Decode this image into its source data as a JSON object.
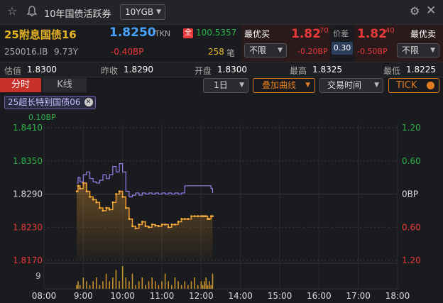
{
  "header": {
    "title": "10年国债活跃券",
    "code_select": "10YGB"
  },
  "quote": {
    "name": "25附息国债16",
    "price": "1.8250",
    "source": "TKN",
    "all_badge": "全",
    "all_value": "100.5357",
    "code": "250016.IB",
    "tenor": "9.73Y",
    "change": "-0.40BP",
    "volume": "258",
    "volume_unit": "笔"
  },
  "bid": {
    "label": "最优买",
    "price_main": "1.82",
    "price_sup": "70",
    "limit": "不限",
    "change": "-0.20BP"
  },
  "spread": {
    "label": "价差",
    "value": "0.30"
  },
  "ask": {
    "label": "最优卖",
    "price_main": "1.82",
    "price_sup": "40",
    "limit": "不限",
    "change": "-0.50BP"
  },
  "stats": [
    {
      "label": "估值",
      "value": "1.8300"
    },
    {
      "label": "昨收",
      "value": "1.8290"
    },
    {
      "label": "开盘",
      "value": "1.8300"
    },
    {
      "label": "最高",
      "value": "1.8325"
    },
    {
      "label": "最低",
      "value": "1.8225"
    }
  ],
  "tabs": [
    {
      "label": "分时",
      "active": true
    },
    {
      "label": "K线",
      "active": false
    }
  ],
  "controls": {
    "period": "1日",
    "overlay": "叠加曲线",
    "session": "交易时间",
    "tick": "TICK"
  },
  "overlay_tag": "25超长特别国债06",
  "colors": {
    "up": "#e8393a",
    "down": "#2db34a",
    "main_line": "#f0a030",
    "overlay_line": "#9b7ff0",
    "accent": "#e07a1f"
  },
  "chart_data": {
    "type": "line",
    "top_label": "0.10BP",
    "y_left_ticks": [
      "1.8410",
      "1.8350",
      "1.8290",
      "1.8230",
      "1.8170"
    ],
    "y_right_ticks": [
      "1.20",
      "0.60",
      "0BP",
      "0.60",
      "1.20"
    ],
    "ylim": [
      1.817,
      1.841
    ],
    "x_ticks": [
      "08:00",
      "9:00",
      "10:00",
      "11:00",
      "12:00",
      "14:00",
      "15:00",
      "16:00",
      "17:00",
      "18:00"
    ],
    "volume_label": "9",
    "series": [
      {
        "name": "25附息国债16",
        "x": [
          "08:50",
          "08:52",
          "08:55",
          "09:00",
          "09:05",
          "09:10",
          "09:15",
          "09:20",
          "09:25",
          "09:30",
          "09:35",
          "09:40",
          "09:45",
          "09:50",
          "09:55",
          "10:00",
          "10:05",
          "10:10",
          "10:15",
          "10:20",
          "10:25",
          "10:30",
          "10:35",
          "10:40",
          "10:45",
          "10:50",
          "10:55",
          "11:00",
          "11:05",
          "11:10",
          "11:15",
          "11:20",
          "11:25",
          "11:30",
          "11:35",
          "11:40",
          "11:45",
          "11:50",
          "11:55",
          "12:00",
          "12:05",
          "12:10",
          "12:15",
          "12:20",
          "12:25",
          "12:30",
          "12:35"
        ],
        "values": [
          1.8295,
          1.8305,
          1.83,
          1.831,
          1.8295,
          1.8285,
          1.828,
          1.8275,
          1.8265,
          1.826,
          1.8265,
          1.8262,
          1.8275,
          1.829,
          1.8295,
          1.8285,
          1.8265,
          1.8245,
          1.8232,
          1.8228,
          1.8235,
          1.824,
          1.8232,
          1.823,
          1.8235,
          1.8233,
          1.8232,
          1.8235,
          1.8235,
          1.823,
          1.8235,
          1.8235,
          1.824,
          1.8245,
          1.8245,
          1.8245,
          1.825,
          1.825,
          1.825,
          1.825,
          1.825,
          1.825,
          1.825,
          1.8245,
          1.8245,
          1.825,
          1.825
        ]
      },
      {
        "name": "25超长特别国债06",
        "x": [
          "08:50",
          "08:52",
          "08:55",
          "09:00",
          "09:05",
          "09:10",
          "09:15",
          "09:20",
          "09:25",
          "09:30",
          "09:35",
          "09:40",
          "09:45",
          "09:50",
          "09:55",
          "10:00",
          "10:05",
          "10:10",
          "10:15",
          "10:20",
          "10:25",
          "10:30",
          "10:35",
          "10:40",
          "10:45",
          "10:50",
          "10:55",
          "11:00",
          "11:05",
          "11:10",
          "11:15",
          "11:20",
          "11:25",
          "11:30",
          "11:35",
          "11:40",
          "11:45",
          "11:50",
          "11:55",
          "12:00",
          "12:05",
          "12:10",
          "12:15",
          "12:20",
          "12:25",
          "12:30",
          "12:35"
        ],
        "values": [
          1.831,
          1.832,
          1.8312,
          1.8325,
          1.833,
          1.8318,
          1.8312,
          1.831,
          1.8315,
          1.8325,
          1.8318,
          1.8325,
          1.834,
          1.833,
          1.8345,
          1.833,
          1.8295,
          1.8285,
          1.8288,
          1.8292,
          1.8288,
          1.8292,
          1.829,
          1.8292,
          1.829,
          1.8292,
          1.829,
          1.8292,
          1.829,
          1.8292,
          1.829,
          1.8292,
          1.829,
          1.8292,
          1.8305,
          1.8305,
          1.8305,
          1.8305,
          1.8305,
          1.8305,
          1.8305,
          1.8305,
          1.8305,
          1.8305,
          1.8305,
          1.83,
          1.8292
        ]
      }
    ],
    "volume": [
      1,
      2,
      1,
      3,
      2,
      1,
      2,
      3,
      1,
      2,
      4,
      2,
      3,
      5,
      2,
      6,
      3,
      2,
      4,
      1,
      2,
      3,
      1,
      2,
      3,
      2,
      1,
      2,
      4,
      2,
      1,
      3,
      2,
      1,
      2,
      1,
      2,
      3,
      1,
      2,
      1,
      2,
      3,
      1,
      2,
      1,
      4
    ]
  }
}
